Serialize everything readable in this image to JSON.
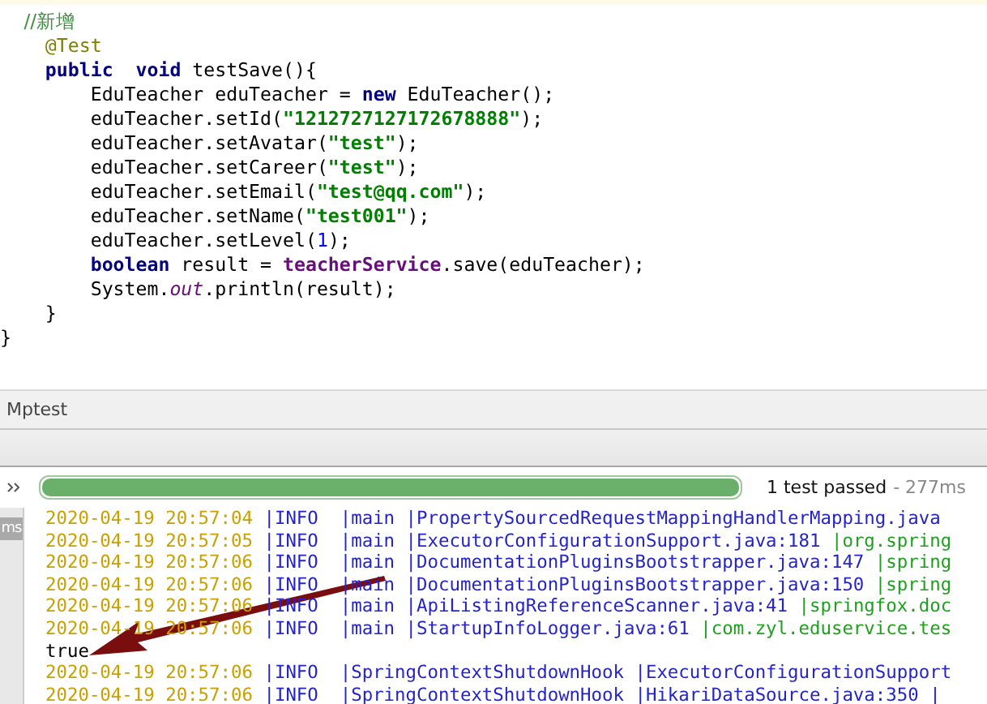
{
  "editor": {
    "lines": [
      [
        {
          "kind": "comment",
          "text": "    //新增"
        }
      ],
      [
        {
          "kind": "annotation",
          "text": "    @Test"
        }
      ],
      [
        {
          "kind": "keyword",
          "text": "    public"
        },
        {
          "kind": "keyword",
          "text": "  void"
        },
        {
          "kind": "plain",
          "text": " testSave(){"
        }
      ],
      [
        {
          "kind": "plain",
          "text": "        EduTeacher eduTeacher = "
        },
        {
          "kind": "keyword",
          "text": "new"
        },
        {
          "kind": "plain",
          "text": " EduTeacher();"
        }
      ],
      [
        {
          "kind": "plain",
          "text": "        eduTeacher.setId("
        },
        {
          "kind": "string",
          "text": "\"1212727127172678888\""
        },
        {
          "kind": "plain",
          "text": ");"
        }
      ],
      [
        {
          "kind": "plain",
          "text": "        eduTeacher.setAvatar("
        },
        {
          "kind": "string",
          "text": "\"test\""
        },
        {
          "kind": "plain",
          "text": ");"
        }
      ],
      [
        {
          "kind": "plain",
          "text": "        eduTeacher.setCareer("
        },
        {
          "kind": "string",
          "text": "\"test\""
        },
        {
          "kind": "plain",
          "text": ");"
        }
      ],
      [
        {
          "kind": "plain",
          "text": "        eduTeacher.setEmail("
        },
        {
          "kind": "string",
          "text": "\"test@qq.com\""
        },
        {
          "kind": "plain",
          "text": ");"
        }
      ],
      [
        {
          "kind": "plain",
          "text": "        eduTeacher.setName("
        },
        {
          "kind": "string",
          "text": "\"test001\""
        },
        {
          "kind": "plain",
          "text": ");"
        }
      ],
      [
        {
          "kind": "plain",
          "text": "        eduTeacher.setLevel("
        },
        {
          "kind": "number",
          "text": "1"
        },
        {
          "kind": "plain",
          "text": ");"
        }
      ],
      [
        {
          "kind": "keyword",
          "text": "        boolean"
        },
        {
          "kind": "plain",
          "text": " result = "
        },
        {
          "kind": "field",
          "text": "teacherService"
        },
        {
          "kind": "plain",
          "text": ".save(eduTeacher);"
        }
      ],
      [
        {
          "kind": "plain",
          "text": "        System."
        },
        {
          "kind": "static",
          "text": "out"
        },
        {
          "kind": "plain",
          "text": ".println(result);"
        }
      ],
      [
        {
          "kind": "plain",
          "text": "    }"
        }
      ],
      [
        {
          "kind": "plain",
          "text": "}"
        }
      ]
    ]
  },
  "run_panel": {
    "title": "Mptest",
    "progress": {
      "level": 1,
      "status": "1 test passed",
      "duration": "- 277ms"
    },
    "side_tab": "ms"
  },
  "console": [
    [
      {
        "kind": "time",
        "text": "2020-04-19 20:57:04 "
      },
      {
        "kind": "info",
        "text": "|INFO  |main |PropertySourcedRequestMappingHandlerMapping.java"
      }
    ],
    [
      {
        "kind": "time",
        "text": "2020-04-19 20:57:05 "
      },
      {
        "kind": "info",
        "text": "|INFO  |main |ExecutorConfigurationSupport.java:181 "
      },
      {
        "kind": "logger",
        "text": "|org.spring"
      }
    ],
    [
      {
        "kind": "time",
        "text": "2020-04-19 20:57:06 "
      },
      {
        "kind": "info",
        "text": "|INFO  |main |DocumentationPluginsBootstrapper.java:147 "
      },
      {
        "kind": "logger",
        "text": "|spring"
      }
    ],
    [
      {
        "kind": "time",
        "text": "2020-04-19 20:57:06 "
      },
      {
        "kind": "info",
        "text": "|INFO  |main |DocumentationPluginsBootstrapper.java:150 "
      },
      {
        "kind": "logger",
        "text": "|spring"
      }
    ],
    [
      {
        "kind": "time",
        "text": "2020-04-19 20:57:06 "
      },
      {
        "kind": "info",
        "text": "|INFO  |main |ApiListingReferenceScanner.java:41 "
      },
      {
        "kind": "logger",
        "text": "|springfox.doc"
      }
    ],
    [
      {
        "kind": "time",
        "text": "2020-04-19 20:57:06 "
      },
      {
        "kind": "info",
        "text": "|INFO  |main |StartupInfoLogger.java:61 "
      },
      {
        "kind": "logger",
        "text": "|com.zyl.eduservice.tes"
      }
    ],
    [
      {
        "kind": "output",
        "text": "true"
      }
    ],
    [
      {
        "kind": "time",
        "text": "2020-04-19 20:57:06 "
      },
      {
        "kind": "info",
        "text": "|INFO  |SpringContextShutdownHook |ExecutorConfigurationSupport"
      }
    ],
    [
      {
        "kind": "time",
        "text": "2020-04-19 20:57:06 "
      },
      {
        "kind": "info",
        "text": "|INFO  |SpringContextShutdownHook |HikariDataSource.java:350 |"
      }
    ]
  ]
}
